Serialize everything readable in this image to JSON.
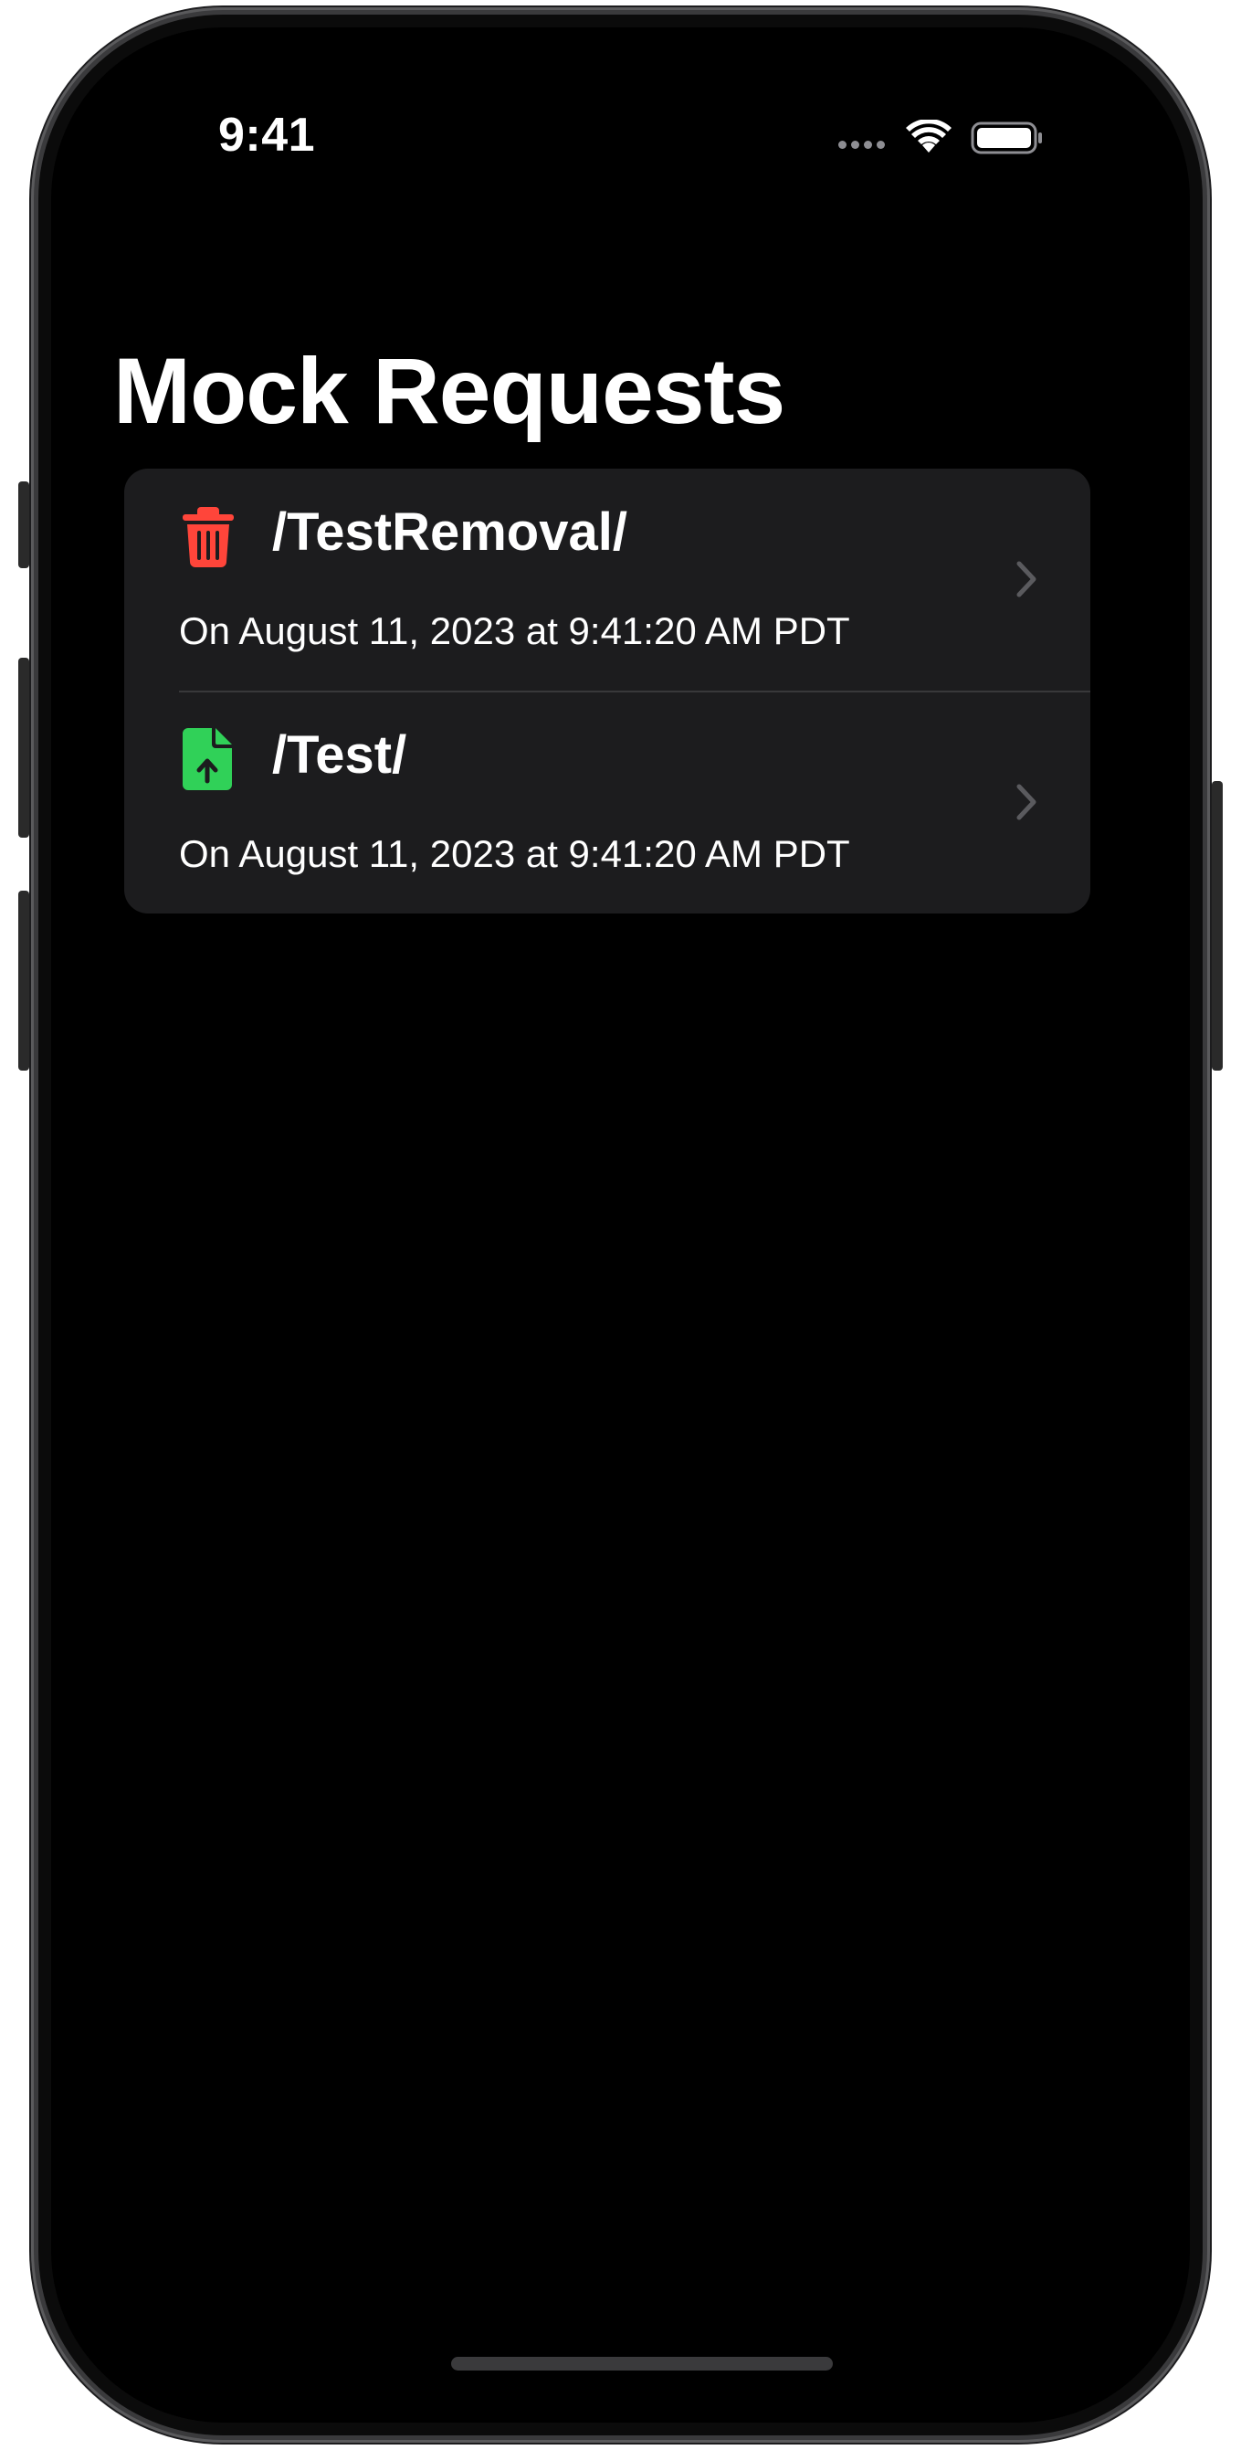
{
  "status_bar": {
    "time": "9:41"
  },
  "title": "Mock Requests",
  "requests": [
    {
      "path": "/TestRemoval/",
      "date": "On August 11, 2023 at 9:41:20 AM PDT",
      "icon": "trash-icon",
      "icon_color": "#ff453a"
    },
    {
      "path": "/Test/",
      "date": "On August 11, 2023 at 9:41:20 AM PDT",
      "icon": "doc-upload-icon",
      "icon_color": "#30d158"
    }
  ],
  "colors": {
    "background": "#000000",
    "card": "#1c1c1e",
    "separator": "#38383a",
    "chevron": "#5a5a5e",
    "text": "#ffffff"
  }
}
